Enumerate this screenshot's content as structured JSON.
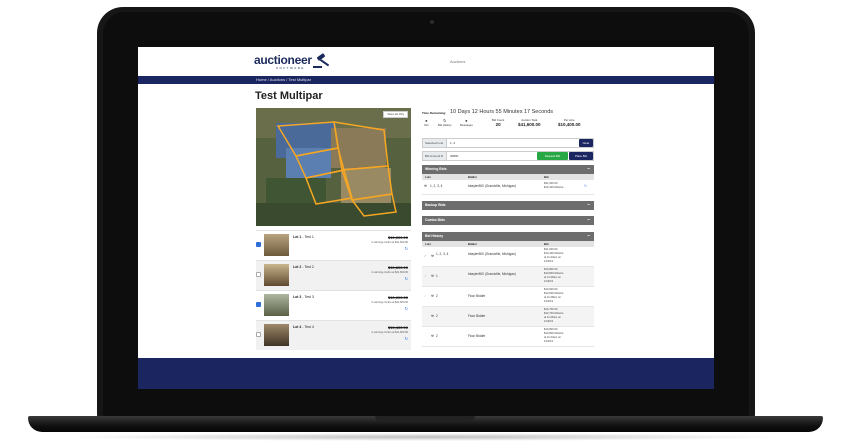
{
  "header": {
    "logo_text": "auctioneer",
    "logo_sub": "SOFTWARE",
    "nav_link": "Auctions"
  },
  "breadcrumb": "Home / Auctions / Test Multipar",
  "page_title": "Test Multipar",
  "map": {
    "button_label": "View Lots Only"
  },
  "lots": [
    {
      "lot": "Lot 1",
      "name": "Test 1",
      "price": "$10,600.00",
      "note": "in winning combo at $41,600.00",
      "checked": true
    },
    {
      "lot": "Lot 2",
      "name": "Test 2",
      "price": "$10,800.00",
      "note": "in winning combo at $41,600.00",
      "checked": false
    },
    {
      "lot": "Lot 3",
      "name": "Test 3",
      "price": "$10,600.00",
      "note": "in winning combo at $41,600.00",
      "checked": true
    },
    {
      "lot": "Lot 4",
      "name": "Test 4",
      "price": "$10,400.00",
      "note": "in winning combo at $41,600.00",
      "checked": false
    }
  ],
  "timer": {
    "label": "Time Remaining:",
    "value": "10 Days 12 Hours 55 Minutes 17 Seconds"
  },
  "stats": {
    "info_label": "Info",
    "bid_label": "Bid",
    "history_label": "History",
    "messages_label": "Messages",
    "bid_count_label": "Bid Count",
    "bid_count": "20",
    "auction_total_label": "Auction Total",
    "auction_total": "$41,600.00",
    "per_acre_label": "Per Acre",
    "per_acre": "$10,400.00"
  },
  "bidform": {
    "selected_lots_label": "Selected Lots",
    "selected_lots": "1, 2",
    "clear_label": "Clear",
    "bid_amount_label": "Bid Amount $",
    "bid_amount": "20800",
    "request_label": "Request Bid",
    "place_label": "Place Bid"
  },
  "winning": {
    "title": "Winning Bids",
    "col_lots": "Lots",
    "col_bidder": "Bidder",
    "col_bid": "Bid",
    "rows": [
      {
        "lots": "1, 2, 3, 4",
        "bidder": "bbayter500 (Grandville, Michigan)",
        "bid1": "$41,600.00",
        "bid2": "$10,400.00/acre"
      }
    ]
  },
  "backup": {
    "title": "Backup Bids"
  },
  "combo": {
    "title": "Combo Bids"
  },
  "history": {
    "title": "Bid History",
    "col_lots": "Lots",
    "col_bidder": "Bidder",
    "col_bid": "Bid",
    "rows": [
      {
        "lots": "1, 2, 3, 4",
        "bidder": "bbayter500 (Grandville, Michigan)",
        "bid1": "$41,600.00",
        "bid2": "$10,400.00/acre",
        "bid3": "at 11:43am on",
        "bid4": "12/3/19"
      },
      {
        "lots": "1",
        "bidder": "bbayter500 (Grandville, Michigan)",
        "bid1": "$10,800.00",
        "bid2": "$10,800.00/acre",
        "bid3": "at 11:29am on",
        "bid4": "12/3/19"
      },
      {
        "lots": "2",
        "bidder": "Floor Bidder",
        "bid1": "$10,600.00",
        "bid2": "$10,600.00/acre",
        "bid3": "at 11:28am on",
        "bid4": "12/3/19"
      },
      {
        "lots": "2",
        "bidder": "Floor Bidder",
        "bid1": "$10,700.00",
        "bid2": "$10,700.00/acre",
        "bid3": "at 11:26am on",
        "bid4": "12/3/19"
      },
      {
        "lots": "2",
        "bidder": "Floor Bidder",
        "bid1": "$10,800.00",
        "bid2": "$10,800.00/acre",
        "bid3": "at 11:24am on",
        "bid4": "12/3/19"
      }
    ]
  },
  "colors": {
    "brand_navy": "#1b2560",
    "success_green": "#28a745",
    "link_blue": "#2f6fd8",
    "panel_gray": "#6d6d6d"
  }
}
